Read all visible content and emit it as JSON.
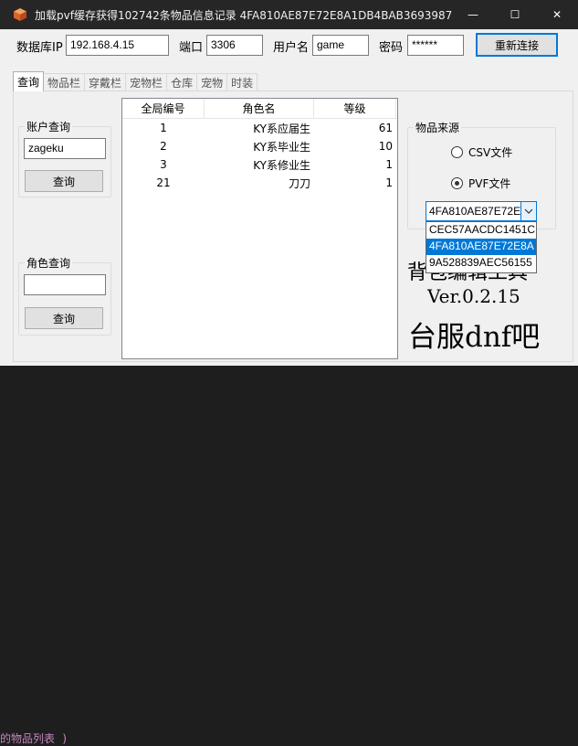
{
  "window": {
    "title": "加载pvf缓存获得102742条物品信息记录 4FA810AE87E72E8A1DB4BAB3693987...",
    "minimize_glyph": "—",
    "maximize_glyph": "☐",
    "close_glyph": "✕"
  },
  "background": {
    "bottom_text": "的物品列表 )"
  },
  "connection": {
    "ip_label": "数据库IP",
    "ip_value": "192.168.4.15",
    "port_label": "端口",
    "port_value": "3306",
    "user_label": "用户名",
    "user_value": "game",
    "password_label": "密码",
    "password_value": "******",
    "reconnect_label": "重新连接"
  },
  "tabs": [
    "查询",
    "物品栏",
    "穿戴栏",
    "宠物栏",
    "仓库",
    "宠物",
    "时装"
  ],
  "account_query": {
    "title": "账户查询",
    "input_value": "zageku",
    "button_label": "查询"
  },
  "role_query": {
    "title": "角色查询",
    "input_value": "",
    "button_label": "查询"
  },
  "role_list": {
    "columns": [
      "全局编号",
      "角色名",
      "等级"
    ],
    "rows": [
      {
        "id": "1",
        "name": "KY系应届生",
        "level": "61"
      },
      {
        "id": "2",
        "name": "KY系毕业生",
        "level": "10"
      },
      {
        "id": "3",
        "name": "KY系修业生",
        "level": "1"
      },
      {
        "id": "21",
        "name": "刀刀",
        "level": "1"
      }
    ]
  },
  "item_source": {
    "title": "物品来源",
    "options": [
      {
        "label": "CSV文件",
        "checked": false
      },
      {
        "label": "PVF文件",
        "checked": true
      }
    ],
    "combo_value": "4FA810AE87E72E",
    "dropdown_items": [
      {
        "label": "CEC57AACDC1451CI",
        "selected": false
      },
      {
        "label": "4FA810AE87E72E8A",
        "selected": true
      },
      {
        "label": "9A528839AEC56155",
        "selected": false
      }
    ]
  },
  "footer": {
    "tool_name_partial": "背包编辑工具",
    "version": "Ver.0.2.15",
    "tagline": "台服dnf吧"
  }
}
